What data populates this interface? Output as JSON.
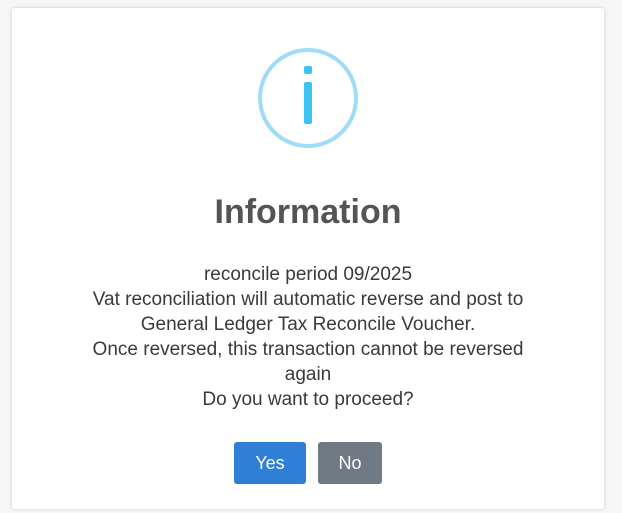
{
  "dialog": {
    "icon": "info-icon",
    "title": "Information",
    "message_lines": [
      "reconcile period 09/2025",
      "Vat reconciliation will automatic reverse and post to",
      "General Ledger Tax Reconcile Voucher.",
      "Once reversed, this transaction cannot be reversed",
      "again",
      "Do you want to proceed?"
    ],
    "buttons": {
      "yes": "Yes",
      "no": "No"
    }
  },
  "colors": {
    "icon_ring": "#9fdcf7",
    "icon_fill": "#3cc3ef",
    "title_text": "#545454",
    "message_text": "#3a3a3a",
    "yes_button": "#2f7fd6",
    "no_button": "#6f7a84"
  }
}
